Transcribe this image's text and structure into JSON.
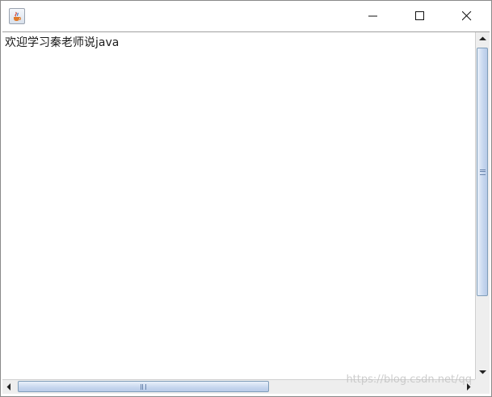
{
  "window": {
    "title": "",
    "app_icon": "java-cup-icon",
    "controls": {
      "minimize": "minimize-icon",
      "maximize": "maximize-icon",
      "close": "close-icon"
    }
  },
  "textarea": {
    "content": "欢迎学习秦老师说java"
  },
  "scrollbars": {
    "vertical": {
      "position": 0
    },
    "horizontal": {
      "position": 0
    }
  },
  "watermark": "https://blog.csdn.net/qq",
  "colors": {
    "thumb_border": "#7f9db9",
    "thumb_fill": "#c6d6ee",
    "track": "#eeeeee",
    "frame_border": "#8a8a8a"
  }
}
